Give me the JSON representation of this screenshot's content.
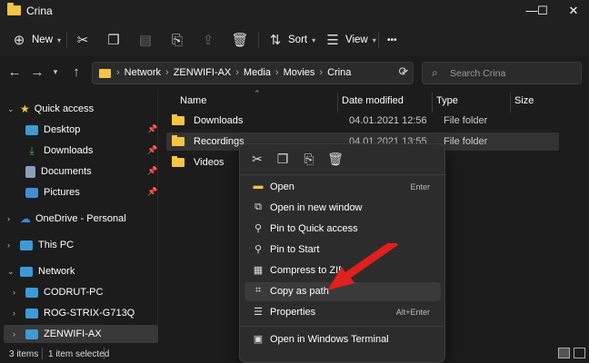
{
  "window": {
    "title": "Crina",
    "minimize": "—",
    "maximize": "☐",
    "close": "✕"
  },
  "toolbar": {
    "new_label": "New",
    "sort_label": "Sort",
    "view_label": "View",
    "more": "•••"
  },
  "address": {
    "breadcrumbs": [
      "Network",
      "ZENWIFI-AX",
      "Media",
      "Movies",
      "Crina"
    ],
    "search_placeholder": "Search Crina"
  },
  "sidebar": {
    "items": [
      {
        "label": "Quick access",
        "level": 0,
        "color": "#f6c343"
      },
      {
        "label": "Desktop",
        "level": 1,
        "color": "#3c9bd6",
        "pinned": true
      },
      {
        "label": "Downloads",
        "level": 1,
        "color": "#3fb36b",
        "pinned": true
      },
      {
        "label": "Documents",
        "level": 1,
        "color": "#8aa0b8",
        "pinned": true
      },
      {
        "label": "Pictures",
        "level": 1,
        "color": "#3f8fd6",
        "pinned": true
      },
      {
        "label": "OneDrive - Personal",
        "level": 0,
        "color": "#2e8bdc"
      },
      {
        "label": "This PC",
        "level": 0,
        "color": "#3c9bd6"
      },
      {
        "label": "Network",
        "level": 0,
        "color": "#3c9bd6"
      },
      {
        "label": "CODRUT-PC",
        "level": 1,
        "color": "#3c9bd6"
      },
      {
        "label": "ROG-STRIX-G713Q",
        "level": 1,
        "color": "#3c9bd6"
      },
      {
        "label": "ZENWIFI-AX",
        "level": 1,
        "color": "#3c9bd6",
        "selected": true
      }
    ]
  },
  "columns": {
    "name": "Name",
    "date": "Date modified",
    "type": "Type",
    "size": "Size"
  },
  "files": [
    {
      "name": "Downloads",
      "date": "04.01.2021 12:56",
      "type": "File folder"
    },
    {
      "name": "Recordings",
      "date": "04.01.2021 13:55",
      "type": "File folder"
    },
    {
      "name": "Videos",
      "date": "",
      "type": ""
    }
  ],
  "status": {
    "items": "3 items",
    "selected": "1 item selected"
  },
  "context_menu": {
    "items": [
      {
        "label": "Open",
        "shortcut": "Enter"
      },
      {
        "label": "Open in new window",
        "shortcut": ""
      },
      {
        "label": "Pin to Quick access",
        "shortcut": ""
      },
      {
        "label": "Pin to Start",
        "shortcut": ""
      },
      {
        "label": "Compress to ZIP file",
        "shortcut": ""
      },
      {
        "label": "Copy as path",
        "shortcut": ""
      },
      {
        "label": "Properties",
        "shortcut": "Alt+Enter"
      },
      {
        "label": "Open in Windows Terminal",
        "shortcut": ""
      }
    ]
  },
  "colors": {
    "background": "#1c1c1c",
    "folder": "#f6c343",
    "arrow": "#e0201c"
  }
}
